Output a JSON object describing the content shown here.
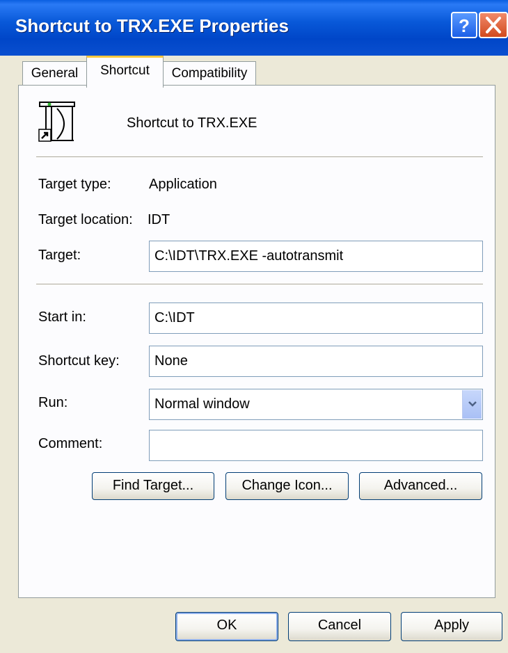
{
  "window": {
    "title": "Shortcut to TRX.EXE Properties",
    "help_icon": "help-icon",
    "close_icon": "close-icon",
    "accent_color": "#0a5fe0"
  },
  "tabs": [
    {
      "label": "General"
    },
    {
      "label": "Shortcut",
      "active": true
    },
    {
      "label": "Compatibility"
    }
  ],
  "shortcut": {
    "icon": "shortcut-app-icon",
    "name": "Shortcut to TRX.EXE",
    "target_type_label": "Target type:",
    "target_type_value": "Application",
    "target_location_label": "Target location:",
    "target_location_value": "IDT",
    "target_label": "Target:",
    "target_value": "C:\\IDT\\TRX.EXE -autotransmit",
    "start_in_label": "Start in:",
    "start_in_value": "C:\\IDT",
    "shortcut_key_label": "Shortcut key:",
    "shortcut_key_value": "None",
    "run_label": "Run:",
    "run_value": "Normal window",
    "comment_label": "Comment:",
    "comment_value": ""
  },
  "buttons": {
    "find_target": "Find Target...",
    "change_icon": "Change Icon...",
    "advanced": "Advanced...",
    "ok": "OK",
    "cancel": "Cancel",
    "apply": "Apply"
  }
}
